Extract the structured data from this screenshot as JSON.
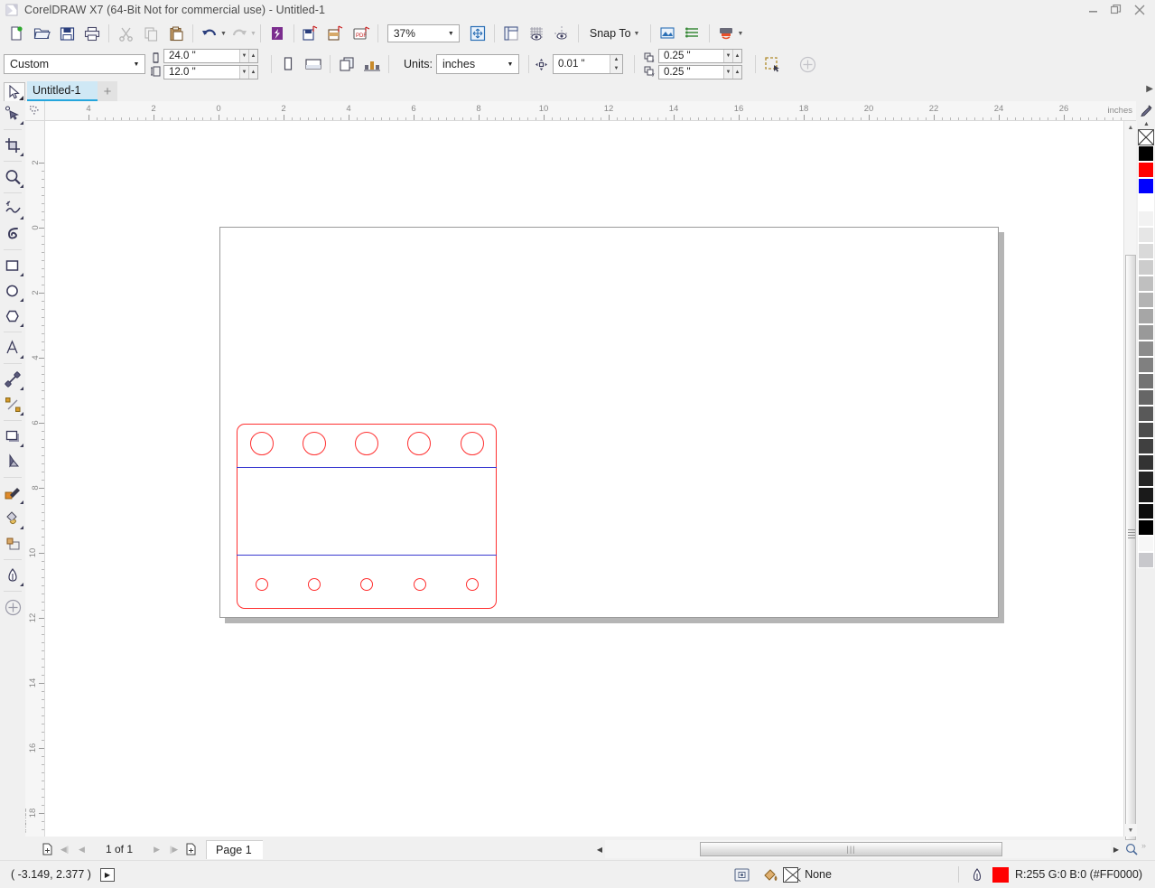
{
  "window": {
    "title": "CorelDRAW X7 (64-Bit Not for commercial use) - Untitled-1",
    "app_icon": "coreldraw-logo-icon",
    "minimize_label": "—",
    "maximize_label": "❐",
    "close_label": "✕"
  },
  "toolbar_main": {
    "items": [
      {
        "name": "new-document-button",
        "icon": "new-document-icon",
        "enabled": true
      },
      {
        "name": "open-document-button",
        "icon": "open-folder-icon",
        "enabled": true
      },
      {
        "name": "save-document-button",
        "icon": "floppy-disk-icon",
        "enabled": true
      },
      {
        "name": "print-button",
        "icon": "printer-icon",
        "enabled": true
      },
      {
        "name": "cut-button",
        "icon": "scissors-icon",
        "enabled": false
      },
      {
        "name": "copy-button",
        "icon": "copy-icon",
        "enabled": false
      },
      {
        "name": "paste-button",
        "icon": "clipboard-icon",
        "enabled": true
      },
      {
        "name": "undo-button",
        "icon": "undo-arrow-icon",
        "enabled": true
      },
      {
        "name": "redo-button",
        "icon": "redo-arrow-icon",
        "enabled": false
      },
      {
        "name": "import-button",
        "icon": "import-icon",
        "enabled": true
      },
      {
        "name": "export-button",
        "icon": "export-icon",
        "enabled": true
      },
      {
        "name": "publish-pdf-button",
        "icon": "pdf-icon",
        "enabled": true
      }
    ],
    "zoom_level": "37%",
    "zoom_dropdown_icon": "chevron-down-icon",
    "fullscreen_icon": "zoom-to-fit-icon",
    "show_rulers_icon": "ruler-icon",
    "show_grid_icon": "grid-icon",
    "show_guides_icon": "guides-icon",
    "snap_to_label": "Snap To",
    "snap_dropdown_icon": "chevron-down-icon",
    "options_icon": "options-icon",
    "object_manager_icon": "object-manager-icon",
    "launch_icon": "application-launcher-icon",
    "launch_dropdown_icon": "chevron-down-icon"
  },
  "property_bar": {
    "page_size_value": "Custom",
    "page_size_dropdown_icon": "chevron-down-icon",
    "page_width_icon": "page-width-icon",
    "page_height_icon": "page-height-icon",
    "page_width": "24.0 \"",
    "page_height": "12.0 \"",
    "portrait_icon": "portrait-orientation-icon",
    "landscape_icon": "landscape-orientation-icon",
    "all_pages_icon": "all-pages-icon",
    "current_page_icon": "current-page-icon",
    "units_label": "Units:",
    "units_value": "inches",
    "units_dropdown_icon": "chevron-down-icon",
    "nudge_icon": "nudge-offset-icon",
    "nudge_value": "0.01 \"",
    "duplicate_x_icon": "duplicate-distance-x-icon",
    "duplicate_y_icon": "duplicate-distance-y-icon",
    "duplicate_x": "0.25 \"",
    "duplicate_y": "0.25 \"",
    "treat_as_filled_icon": "treat-as-filled-icon",
    "add_control_icon": "add-control-icon"
  },
  "document_tabs": {
    "active_tool_icon": "pick-tool-icon",
    "tabs": [
      {
        "label": "Untitled-1",
        "active": true
      }
    ],
    "add_tab_label": "+",
    "expander_icon": "chevron-right-icon"
  },
  "toolbox": {
    "tools": [
      {
        "name": "shape-tool",
        "icon": "shape-node-edit-icon",
        "flyout": true
      },
      {
        "name": "crop-tool",
        "icon": "crop-icon",
        "flyout": true
      },
      {
        "name": "zoom-tool",
        "icon": "magnifier-icon",
        "flyout": true
      },
      {
        "name": "freehand-tool",
        "icon": "freehand-curve-icon",
        "flyout": true
      },
      {
        "name": "artistic-media-tool",
        "icon": "artistic-media-brush-icon",
        "flyout": false
      },
      {
        "name": "rectangle-tool",
        "icon": "rectangle-icon",
        "flyout": true
      },
      {
        "name": "ellipse-tool",
        "icon": "ellipse-icon",
        "flyout": true
      },
      {
        "name": "polygon-tool",
        "icon": "polygon-icon",
        "flyout": true
      },
      {
        "name": "text-tool",
        "icon": "text-letter-a-icon",
        "flyout": true
      },
      {
        "name": "parallel-dimension-tool",
        "icon": "dimension-line-icon",
        "flyout": true
      },
      {
        "name": "straight-line-connector-tool",
        "icon": "connector-line-icon",
        "flyout": true
      },
      {
        "name": "drop-shadow-tool",
        "icon": "drop-shadow-icon",
        "flyout": true
      },
      {
        "name": "transparency-tool",
        "icon": "transparency-icon",
        "flyout": false
      },
      {
        "name": "color-eyedropper-tool",
        "icon": "color-eyedropper-icon",
        "flyout": true
      },
      {
        "name": "interactive-fill-tool",
        "icon": "interactive-fill-icon",
        "flyout": true
      },
      {
        "name": "smart-fill-tool",
        "icon": "smart-fill-icon",
        "flyout": false
      },
      {
        "name": "outline-pen-tool",
        "icon": "outline-pen-icon",
        "flyout": true
      },
      {
        "name": "customize-toolbox-button",
        "icon": "plus-circle-icon",
        "flyout": false
      }
    ]
  },
  "rulers": {
    "horizontal_labels": [
      "4",
      "2",
      "0",
      "2",
      "4",
      "6",
      "8",
      "10",
      "12",
      "14",
      "16",
      "18",
      "20",
      "22",
      "24",
      "26"
    ],
    "vertical_labels": [
      "2",
      "0",
      "2",
      "4",
      "6",
      "8",
      "10",
      "12",
      "14",
      "16",
      "18"
    ],
    "unit_label": "inches",
    "vertical_unit_label": "inches",
    "origin_icon": "ruler-origin-icon"
  },
  "artwork": {
    "description": "box-die-line-drawing",
    "outline_color": "#ff3030",
    "fold_line_color": "#3a3ad0",
    "top_circles_count": 5,
    "bottom_circles_count": 5,
    "top_circle_radius_px": 13,
    "bottom_circle_radius_px": 7
  },
  "page_navigator": {
    "add_page_start_icon": "add-page-icon",
    "first_page_icon": "first-page-icon",
    "prev_page_icon": "previous-page-icon",
    "page_count_label": "1 of 1",
    "next_page_icon": "next-page-icon",
    "last_page_icon": "last-page-icon",
    "add_page_end_icon": "add-page-icon",
    "page_tabs": [
      {
        "label": "Page 1",
        "active": true
      }
    ]
  },
  "scrollbars": {
    "vertical_up_icon": "chevron-up-icon",
    "vertical_down_icon": "chevron-down-icon",
    "horizontal_left_icon": "chevron-left-icon",
    "horizontal_right_icon": "chevron-right-icon",
    "thumb_grip_label": "|||",
    "zoom_status_icon": "zoom-magnifier-icon"
  },
  "palette": {
    "eyedropper_icon": "palette-eyedropper-icon",
    "scroll_up_icon": "chevron-up-icon",
    "none_swatch_label": "None",
    "swatches": [
      "#000000",
      "#ff0000",
      "#0000ff",
      "#ffffff",
      "#f2f2f2",
      "#e6e6e6",
      "#d9d9d9",
      "#cccccc",
      "#bfbfbf",
      "#b3b3b3",
      "#a6a6a6",
      "#999999",
      "#8c8c8c",
      "#808080",
      "#737373",
      "#666666",
      "#595959",
      "#4d4d4d",
      "#404040",
      "#333333",
      "#262626",
      "#1a1a1a",
      "#0d0d0d",
      "#000000",
      "#f7f7f7",
      "#c8c8cc"
    ]
  },
  "status_bar": {
    "cursor_position": "( -3.149, 2.377 )",
    "cursor_toggle_icon": "play-triangle-icon",
    "snap_indicator_icon": "snap-indicator-icon",
    "fill_icon": "fill-bucket-icon",
    "fill_value": "None",
    "outline_icon": "outline-pen-nib-icon",
    "outline_color": "#ff0000",
    "outline_value": "R:255 G:0 B:0 (#FF0000)"
  }
}
